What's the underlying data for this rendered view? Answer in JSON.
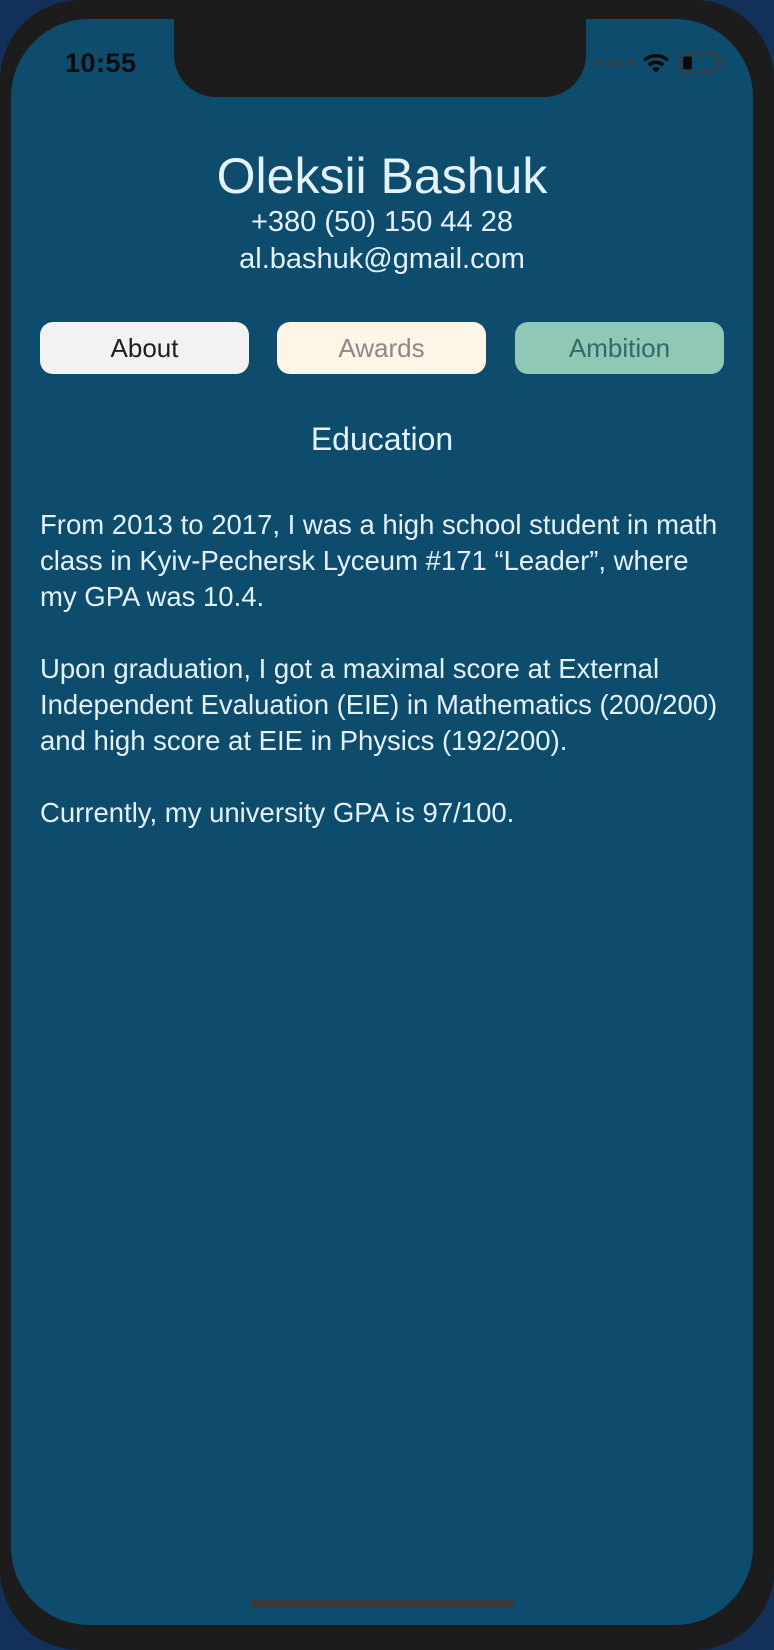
{
  "status_bar": {
    "time": "10:55"
  },
  "profile": {
    "name": "Oleksii Bashuk",
    "phone": "+380 (50) 150 44 28",
    "email": "al.bashuk@gmail.com"
  },
  "tabs": [
    {
      "label": "About",
      "color": "#f2f2f2"
    },
    {
      "label": "Awards",
      "color": "#fdf5e6"
    },
    {
      "label": "Ambition",
      "color": "#90c8b6"
    }
  ],
  "section": {
    "title": "Education",
    "paragraphs": [
      "From 2013 to 2017, I was a high school student in math class in Kyiv-Pechersk Lyceum #171 “Leader”, where my GPA was 10.4.",
      "Upon graduation, I got a maximal score at External Independent Evaluation (EIE) in Mathematics (200/200) and high score at EIE in Physics (192/200).",
      "Currently, my university GPA is 97/100."
    ]
  },
  "colors": {
    "background": "#0d4c6d",
    "text": "#e4f2fb"
  }
}
